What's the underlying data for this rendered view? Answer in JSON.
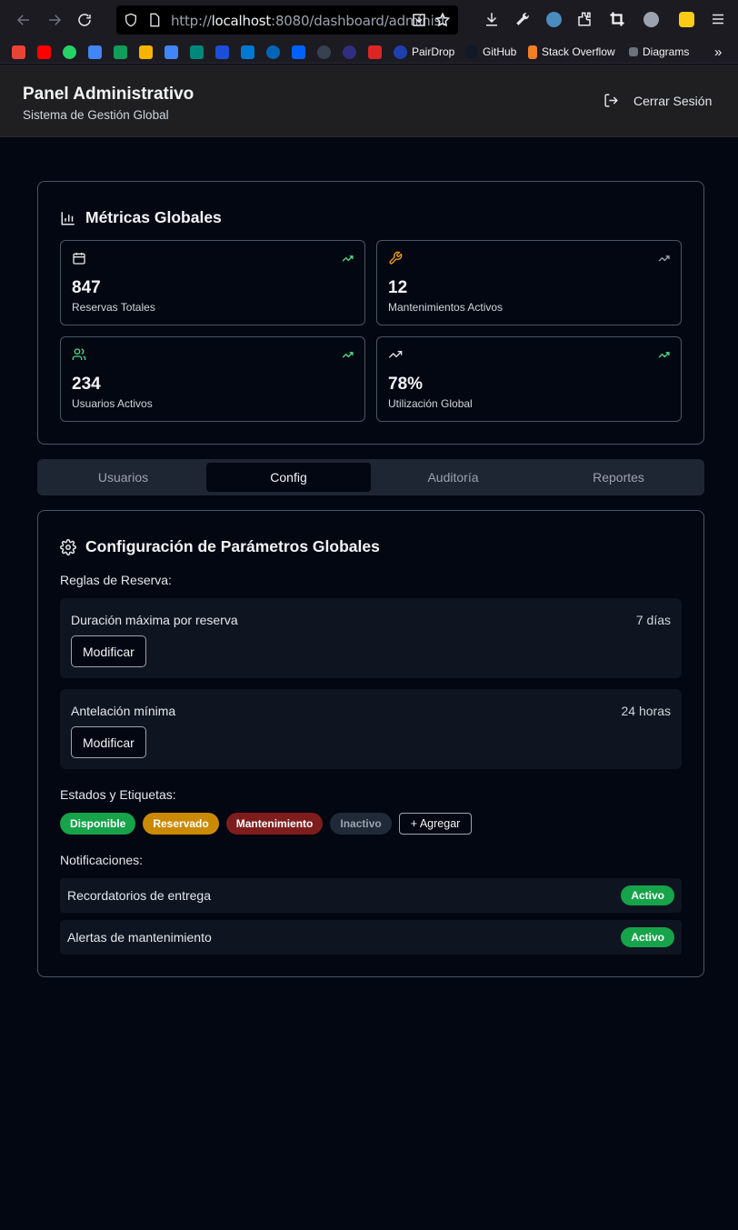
{
  "browser": {
    "url_prefix": "http://",
    "url_host": "localhost",
    "url_rest": ":8080/dashboard/administ",
    "bookmarks": [
      {
        "label": "PairDrop"
      },
      {
        "label": "GitHub"
      },
      {
        "label": "Stack Overflow"
      },
      {
        "label": "Diagrams"
      }
    ]
  },
  "header": {
    "title": "Panel Administrativo",
    "subtitle": "Sistema de Gestión Global",
    "logout_label": "Cerrar Sesión"
  },
  "metrics": {
    "heading": "Métricas Globales",
    "items": [
      {
        "value": "847",
        "label": "Reservas Totales",
        "icon": "calendar-icon",
        "color": "#e5e7eb"
      },
      {
        "value": "12",
        "label": "Mantenimientos Activos",
        "icon": "wrench-icon",
        "color": "#f59e0b"
      },
      {
        "value": "234",
        "label": "Usuarios Activos",
        "icon": "users-icon",
        "color": "#4ade80"
      },
      {
        "value": "78%",
        "label": "Utilización Global",
        "icon": "trending-up-icon",
        "color": "#e5e7eb"
      }
    ],
    "trend_color": "#4ade80"
  },
  "tabs": [
    {
      "label": "Usuarios",
      "active": false
    },
    {
      "label": "Config",
      "active": true
    },
    {
      "label": "Auditoría",
      "active": false
    },
    {
      "label": "Reportes",
      "active": false
    }
  ],
  "config": {
    "heading": "Configuración de Parámetros Globales",
    "rules_label": "Reglas de Reserva:",
    "rules": [
      {
        "name": "Duración máxima por reserva",
        "value": "7 días",
        "button": "Modificar"
      },
      {
        "name": "Antelación mínima",
        "value": "24 horas",
        "button": "Modificar"
      }
    ],
    "states_label": "Estados y Etiquetas:",
    "states": [
      {
        "label": "Disponible",
        "color": "#16a34a",
        "text_color": "#ffffff"
      },
      {
        "label": "Reservado",
        "color": "#ca8a04",
        "text_color": "#ffffff"
      },
      {
        "label": "Mantenimiento",
        "color": "#7f1d1d",
        "text_color": "#ffffff"
      },
      {
        "label": "Inactivo",
        "color": "#1f2937",
        "text_color": "#9ca3af"
      }
    ],
    "add_label": "+ Agregar",
    "notifications_label": "Notificaciones:",
    "notifications": [
      {
        "label": "Recordatorios de entrega",
        "status": "Activo"
      },
      {
        "label": "Alertas de mantenimiento",
        "status": "Activo"
      }
    ]
  }
}
